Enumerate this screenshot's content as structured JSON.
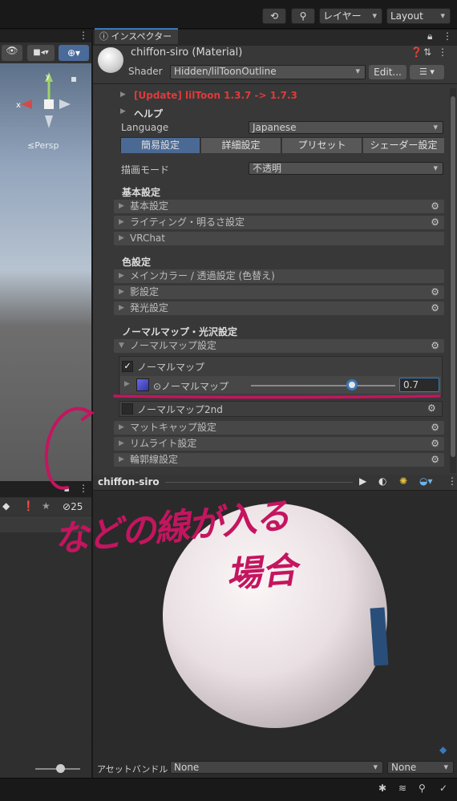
{
  "toolbar": {
    "history_icon": "history-icon",
    "search_icon": "search-icon",
    "layers_label": "レイヤー",
    "layout_label": "Layout"
  },
  "scene": {
    "persp_label": "≤Persp",
    "axis_x": "x",
    "axis_y": "y"
  },
  "left_panel": {
    "hidden_count": "25"
  },
  "inspector": {
    "tab_label": "インスペクター",
    "material_name": "chiffon-siro (Material)",
    "shader_label": "Shader",
    "shader_value": "Hidden/lilToonOutline",
    "edit_button": "Edit...",
    "update_notice": "[Update] lilToon 1.3.7 -> 1.7.3",
    "help_label": "ヘルプ",
    "language_label": "Language",
    "language_value": "Japanese",
    "mode_tabs": [
      "簡易設定",
      "詳細設定",
      "プリセット",
      "シェーダー設定"
    ],
    "render_mode_label": "描画モード",
    "render_mode_value": "不透明",
    "basic_section": "基本設定",
    "basic_items": [
      "基本設定",
      "ライティング・明るさ設定",
      "VRChat"
    ],
    "color_section": "色設定",
    "color_items": [
      "メインカラー / 透過設定 (色替え)",
      "影設定",
      "発光設定"
    ],
    "normal_section": "ノーマルマップ・光沢設定",
    "normal_foldout": "ノーマルマップ設定",
    "normal_map_toggle": "ノーマルマップ",
    "normal_map_prop": "⊙ノーマルマップ",
    "normal_map_value": "0.7",
    "normal_map_strength": 0.7,
    "normal_map2_toggle": "ノーマルマップ2nd",
    "other_items": [
      "マットキャップ設定",
      "リムライト設定",
      "輪郭線設定"
    ]
  },
  "preview": {
    "title": "chiffon-siro"
  },
  "bundle": {
    "label": "アセットバンドル",
    "value1": "None",
    "value2": "None"
  },
  "annotation": {
    "line1": "などの線が入る",
    "line2": "場合",
    "color": "#c4155f"
  }
}
